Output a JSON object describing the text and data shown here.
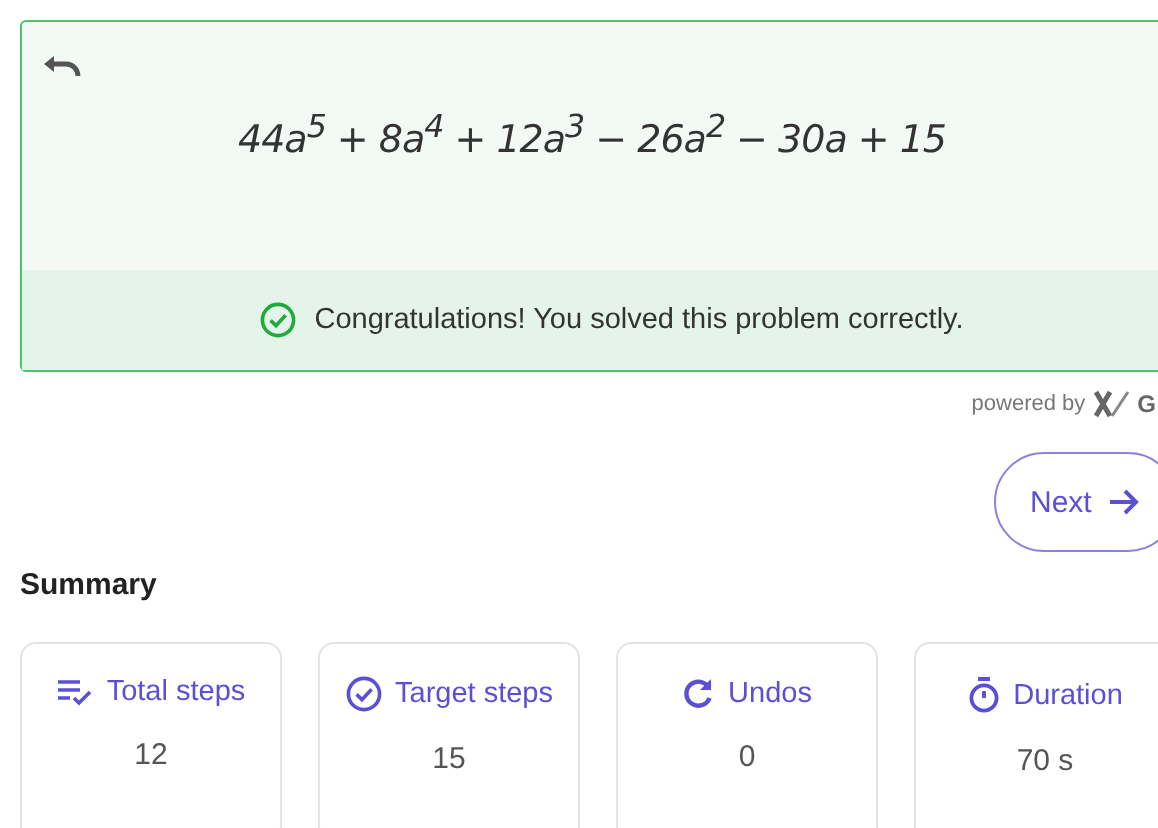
{
  "problem": {
    "expression": "44a$^{5}$ + 8a$^{4}$ + 12a$^{3}$ − 26a$^{2}$ − 30a + 15",
    "feedback": "Congratulations! You solved this problem correctly."
  },
  "powered_by": {
    "label": "powered by",
    "brand": "G"
  },
  "next_button": {
    "label": "Next"
  },
  "summary": {
    "title": "Summary",
    "cards": [
      {
        "kind": "steps",
        "label": "Total steps",
        "value": "12"
      },
      {
        "kind": "target",
        "label": "Target steps",
        "value": "15"
      },
      {
        "kind": "undos",
        "label": "Undos",
        "value": "0"
      },
      {
        "kind": "duration",
        "label": "Duration",
        "value": "70 s"
      }
    ]
  }
}
